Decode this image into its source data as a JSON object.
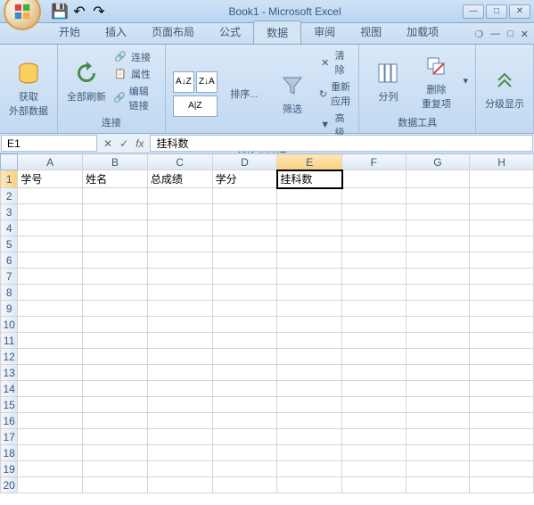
{
  "title": "Book1 - Microsoft Excel",
  "qat": {
    "save": "💾",
    "undo": "↶",
    "redo": "↷"
  },
  "tabs": [
    "开始",
    "插入",
    "页面布局",
    "公式",
    "数据",
    "审阅",
    "视图",
    "加载项"
  ],
  "active_tab_index": 4,
  "ribbon": {
    "grp1": {
      "label": "",
      "btn1": "获取\n外部数据"
    },
    "grp2": {
      "label": "连接",
      "refresh": "全部刷新",
      "conn": "连接",
      "prop": "属性",
      "edit": "编辑链接"
    },
    "grp3": {
      "label": "排序和筛选",
      "sort": "排序...",
      "filter": "筛选",
      "clear": "清除",
      "reapply": "重新应用",
      "adv": "高级"
    },
    "grp4": {
      "label": "数据工具",
      "ttc": "分列",
      "dup": "删除\n重复项"
    },
    "grp5": {
      "label": "",
      "outline": "分级显示"
    }
  },
  "namebox": "E1",
  "fx_label": "fx",
  "formula": "挂科数",
  "columns": [
    "A",
    "B",
    "C",
    "D",
    "E",
    "F",
    "G",
    "H"
  ],
  "active_cell": {
    "row": 1,
    "col": "E"
  },
  "chart_data": {
    "type": "table",
    "headers": [
      "学号",
      "姓名",
      "总成绩",
      "学分",
      "挂科数"
    ],
    "rows": []
  },
  "cells": {
    "A1": "学号",
    "B1": "姓名",
    "C1": "总成绩",
    "D1": "学分",
    "E1": "挂科数"
  },
  "row_count": 20
}
